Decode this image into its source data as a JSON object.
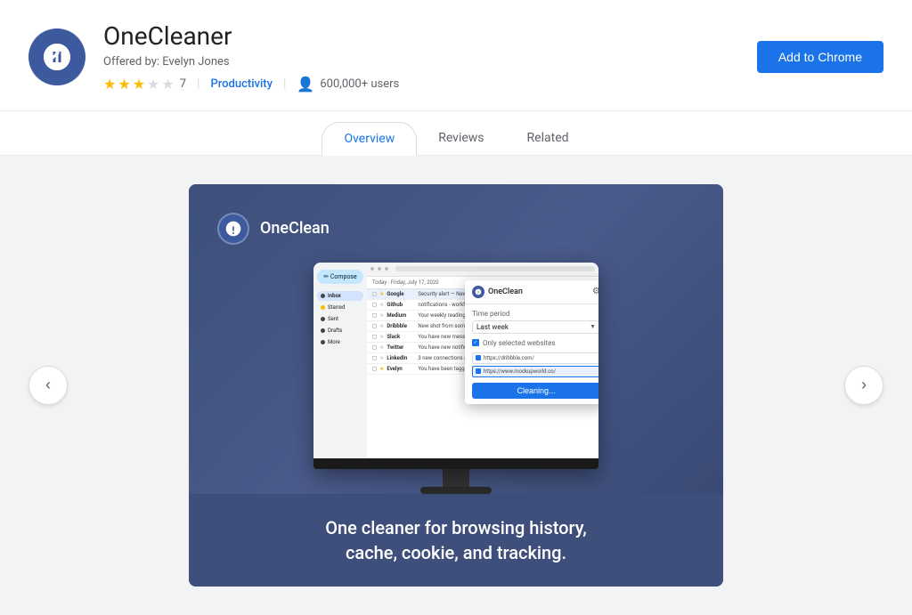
{
  "header": {
    "app_name": "OneCleaner",
    "offered_by_label": "Offered by: Evelyn Jones",
    "rating": 3,
    "max_rating": 5,
    "review_count": "7",
    "category": "Productivity",
    "users": "600,000+ users",
    "add_button_label": "Add to Chrome"
  },
  "tabs": [
    {
      "id": "overview",
      "label": "Overview",
      "active": true
    },
    {
      "id": "reviews",
      "label": "Reviews",
      "active": false
    },
    {
      "id": "related",
      "label": "Related",
      "active": false
    }
  ],
  "carousel": {
    "prev_label": "‹",
    "next_label": "›",
    "slide": {
      "ext_name": "OneClean",
      "caption": "One cleaner for browsing history,\ncache, cookie, and tracking.",
      "popup": {
        "title": "OneClean",
        "time_period_label": "Time period",
        "time_period_value": "Last week",
        "only_selected_label": "Only selected websites",
        "sites": [
          "https://dribbble.com/",
          "https://www.mockupworld.co/"
        ],
        "clean_button_label": "Cleaning..."
      }
    }
  }
}
